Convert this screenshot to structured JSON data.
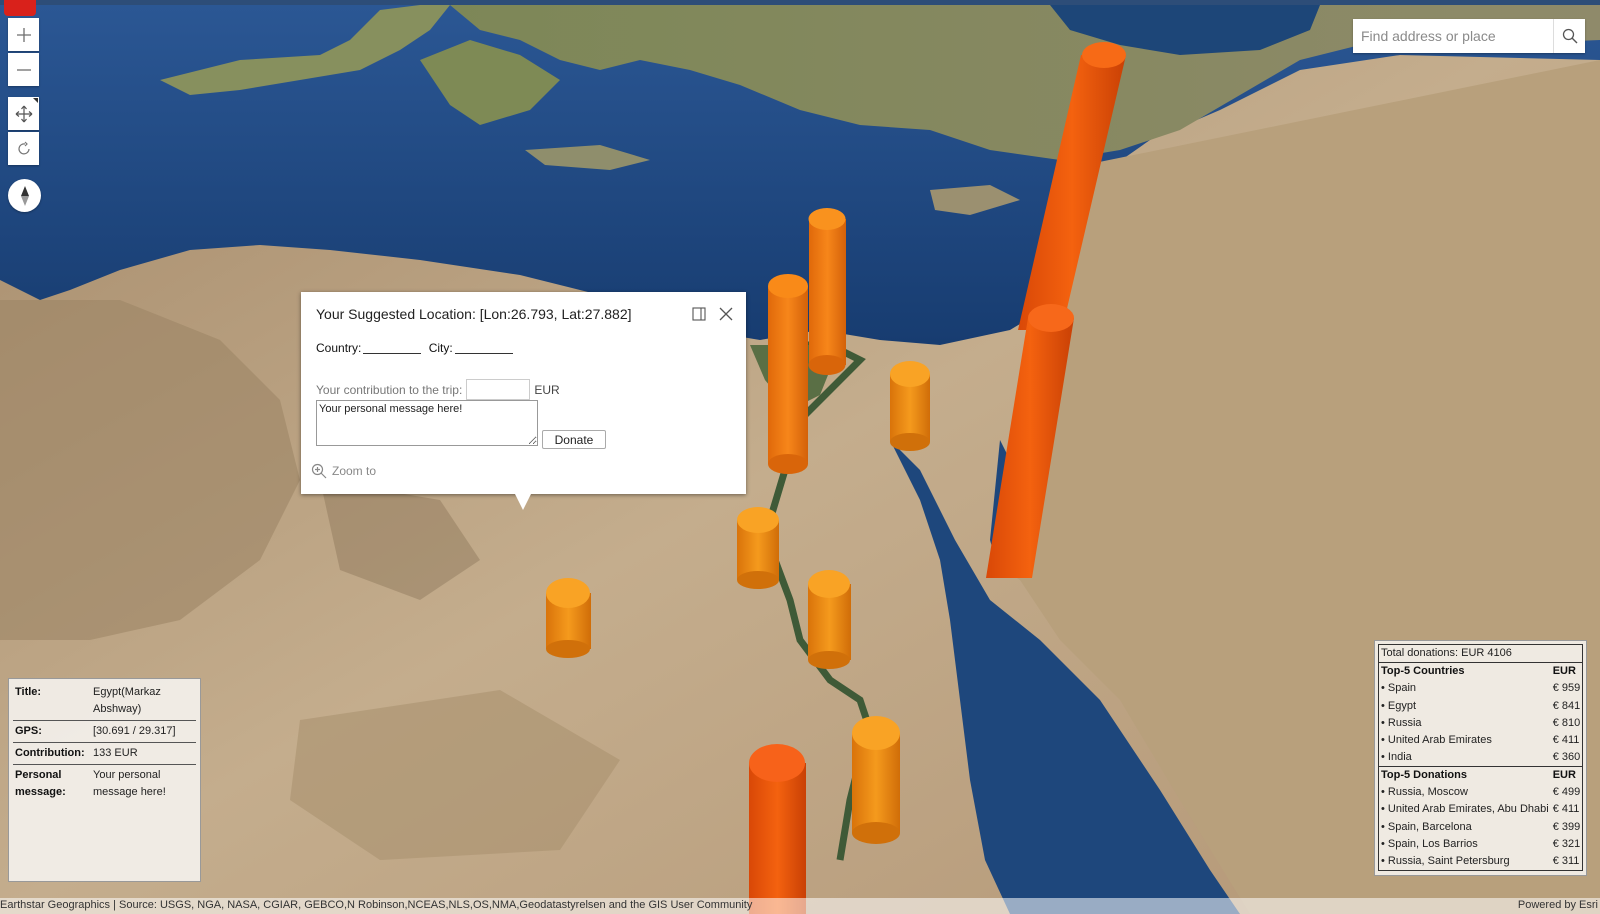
{
  "toolbar": {
    "zoom_in_icon": "plus-icon",
    "zoom_out_icon": "minus-icon",
    "pan_icon": "move-arrows-icon",
    "rotate_icon": "rotate-icon",
    "compass_icon": "compass-icon"
  },
  "search": {
    "placeholder": "Find address or place",
    "icon": "search-icon"
  },
  "popup": {
    "title": "Your Suggested Location: [Lon:26.793, Lat:27.882]",
    "country_label": "Country:",
    "city_label": "City:",
    "contribution_label": "Your contribution to the trip:",
    "contribution_value": "",
    "currency": "EUR",
    "message_value": "Your personal message here!",
    "donate_label": "Donate",
    "zoom_label": "Zoom to"
  },
  "info": {
    "title_label": "Title:",
    "title_value": "Egypt(Markaz Abshway)",
    "gps_label": "GPS:",
    "gps_value": "[30.691 / 29.317]",
    "contribution_label": "Contribution:",
    "contribution_value": "133 EUR",
    "message_label": "Personal message:",
    "message_value": "Your personal message here!"
  },
  "stats": {
    "total": "Total donations: EUR 4106",
    "countries_header": "Top-5 Countries",
    "countries_unit": "EUR",
    "countries": [
      {
        "name": "• Spain",
        "value": "€ 959"
      },
      {
        "name": "• Egypt",
        "value": "€ 841"
      },
      {
        "name": "• Russia",
        "value": "€ 810"
      },
      {
        "name": "• United Arab Emirates",
        "value": "€ 411"
      },
      {
        "name": "• India",
        "value": "€ 360"
      }
    ],
    "donations_header": "Top-5 Donations",
    "donations_unit": "EUR",
    "donations": [
      {
        "name": "• Russia, Moscow",
        "value": "€ 499"
      },
      {
        "name": "• United Arab Emirates, Abu Dhabi",
        "value": "€ 411"
      },
      {
        "name": "• Spain, Barcelona",
        "value": "€ 399"
      },
      {
        "name": "• Spain, Los Barrios",
        "value": "€ 321"
      },
      {
        "name": "• Russia, Saint Petersburg",
        "value": "€ 311"
      }
    ]
  },
  "attribution": {
    "source": "Earthstar Geographics | Source: USGS, NGA, NASA, CGIAR, GEBCO,N Robinson,NCEAS,NLS,OS,NMA,Geodatastyrelsen and the GIS User Community",
    "powered": "Powered by Esri"
  },
  "colors": {
    "sea": "#1f4a82",
    "desert": "#b79e7f",
    "bar_orange": "#f08a0f",
    "bar_red_orange": "#f0520a",
    "frame": "#2d4d78"
  }
}
